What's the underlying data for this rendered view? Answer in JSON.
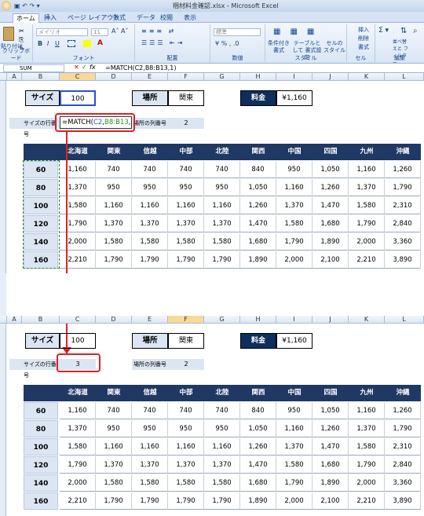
{
  "app": {
    "title": "梱材料金確認.xlsx - Microsoft Excel",
    "tabs": [
      "ホーム",
      "挿入",
      "ページ レイアウト",
      "数式",
      "データ",
      "校閲",
      "表示"
    ]
  },
  "ribbon": {
    "font_name": "メイリオ",
    "font_size": "11",
    "number_format": "標準",
    "groups": [
      "クリップボード",
      "フォント",
      "配置",
      "数値",
      "スタイル",
      "セル",
      "編集"
    ],
    "paste": "貼り付け",
    "insert": "挿入",
    "delete": "削除",
    "format": "書式",
    "sort": "並べ替えと フィルター",
    "find": "検索と 選択",
    "cond_format": "条件付き 書式",
    "table_format": "テーブルとして 書式設定",
    "cell_style": "セルの スタイル"
  },
  "formula_bar": {
    "name_box": "SUM",
    "formula": "=MATCH(C2,B8:B13,1)"
  },
  "columns": [
    "A",
    "B",
    "C",
    "D",
    "E",
    "F",
    "G",
    "H",
    "I",
    "J",
    "K",
    "L"
  ],
  "sheet": {
    "size_label": "サイズ",
    "size_value": "100",
    "place_label": "場所",
    "place_value": "関東",
    "fee_label": "料金",
    "fee_value": "¥1,160",
    "row_index_label": "サイズの行番号",
    "col_index_label": "場所の列番号",
    "col_index_value": "2",
    "formula_edit_a": "=MATCH(",
    "formula_edit_b": "C2",
    "formula_edit_c": ",",
    "formula_edit_d": "B8:B13",
    "formula_edit_e": ",1)",
    "row_index_result": "3",
    "regions": [
      "北海道",
      "関東",
      "信越",
      "中部",
      "北陸",
      "関西",
      "中国",
      "四国",
      "九州",
      "沖縄"
    ],
    "sizes": [
      "60",
      "80",
      "100",
      "120",
      "140",
      "160"
    ],
    "table": [
      [
        "1,160",
        "740",
        "740",
        "740",
        "740",
        "840",
        "950",
        "1,050",
        "1,160",
        "1,260"
      ],
      [
        "1,370",
        "950",
        "950",
        "950",
        "950",
        "1,050",
        "1,160",
        "1,260",
        "1,370",
        "1,790"
      ],
      [
        "1,580",
        "1,160",
        "1,160",
        "1,160",
        "1,160",
        "1,260",
        "1,370",
        "1,470",
        "1,580",
        "2,310"
      ],
      [
        "1,790",
        "1,370",
        "1,370",
        "1,370",
        "1,370",
        "1,470",
        "1,580",
        "1,680",
        "1,790",
        "2,840"
      ],
      [
        "2,000",
        "1,580",
        "1,580",
        "1,580",
        "1,580",
        "1,680",
        "1,790",
        "1,890",
        "2,000",
        "3,360"
      ],
      [
        "2,210",
        "1,790",
        "1,790",
        "1,790",
        "1,790",
        "1,890",
        "2,000",
        "2,100",
        "2,210",
        "3,890"
      ]
    ]
  },
  "colors": {
    "header_bg": "#1f3864",
    "label_bg": "#dce6f2",
    "highlight": "#e02020"
  }
}
